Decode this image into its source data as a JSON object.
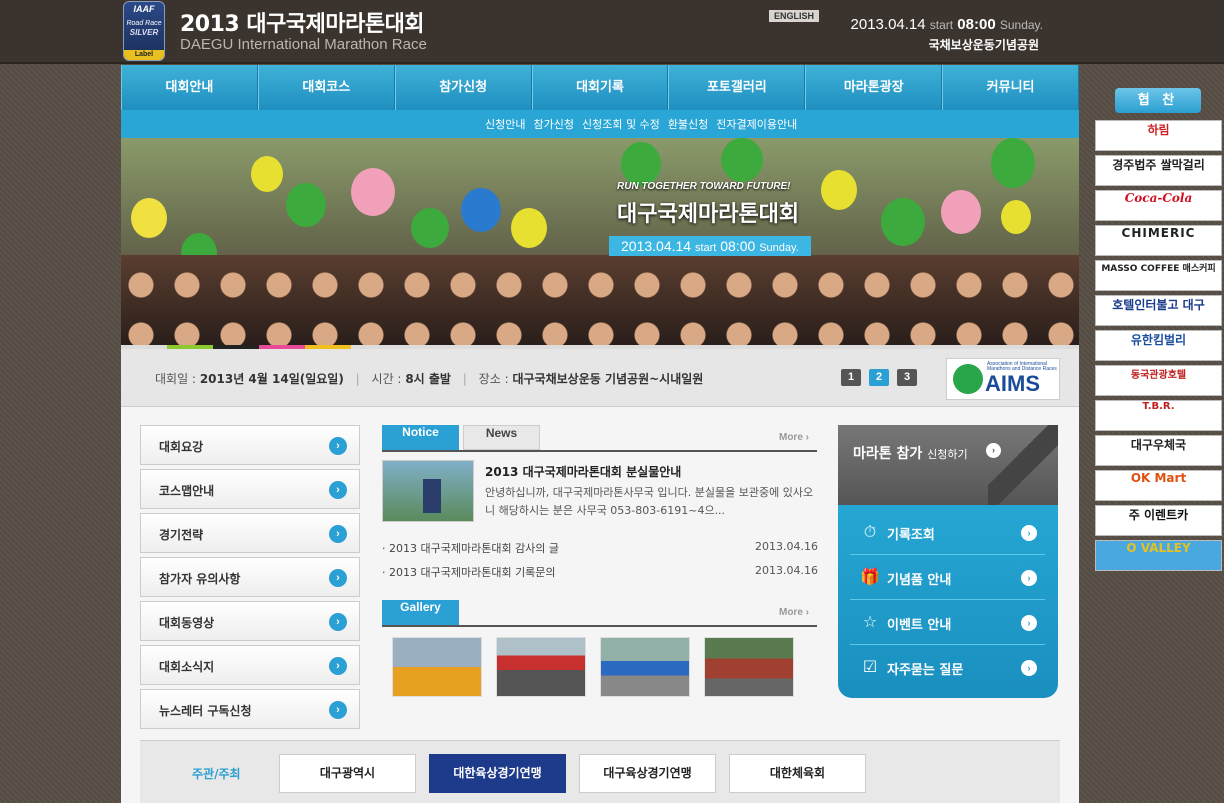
{
  "header": {
    "badge": {
      "iaaf": "IAAF",
      "road": "Road Race",
      "silver": "SILVER",
      "label": "Label"
    },
    "title": "2013 대구국제마라톤대회",
    "subtitle": "DAEGU International Marathon Race",
    "english": "ENGLISH",
    "date": "2013.04.14",
    "start": "start",
    "time": "08:00",
    "day": "Sunday.",
    "place": "국채보상운동기념공원"
  },
  "nav": [
    "대회안내",
    "대회코스",
    "참가신청",
    "대회기록",
    "포토갤러리",
    "마라톤광장",
    "커뮤니티"
  ],
  "subnav": [
    "신청안내",
    "참가신청",
    "신청조회 및 수정",
    "환불신청",
    "전자결제이용안내"
  ],
  "banner": {
    "slogan": "RUN TOGETHER TOWARD FUTURE!",
    "title": "대구국제마라톤대회",
    "date": "2013.04.14",
    "start": "start",
    "time": "08:00",
    "day": "Sunday."
  },
  "info": {
    "date_label": "대회일 :",
    "date_value": "2013년 4월 14일(일요일)",
    "time_label": "시간 :",
    "time_value": "8시 출발",
    "place_label": "장소 :",
    "place_value": "대구국채보상운동 기념공원~시내일원",
    "pages": [
      "1",
      "2",
      "3"
    ],
    "aims_name": "AIMS",
    "aims_tag": "Association of International Marathons and Distance Races"
  },
  "left_menu": [
    "대회요강",
    "코스맵안내",
    "경기전략",
    "참가자 유의사항",
    "대회동영상",
    "대회소식지",
    "뉴스레터 구독신청"
  ],
  "board": {
    "tab_notice": "Notice",
    "tab_news": "News",
    "more": "More",
    "feature_title": "2013 대구국제마라톤대회 분실물안내",
    "feature_summary": "안녕하십니까, 대구국제마라톤사무국 입니다. 분실물을 보관중에 있사오니 해당하시는 분은 사무국 053-803-6191~4으...",
    "items": [
      {
        "title": "2013 대구국제마라톤대회 감사의 글",
        "date": "2013.04.16"
      },
      {
        "title": "2013 대구국제마라톤대회 기록문의",
        "date": "2013.04.16"
      }
    ],
    "gallery_tab": "Gallery",
    "gallery_more": "More"
  },
  "side": {
    "head_main": "마라톤 참가",
    "head_small": "신청하기",
    "items": [
      {
        "label": "기록조회",
        "icon": "⏱"
      },
      {
        "label": "기념품 안내",
        "icon": "🎁"
      },
      {
        "label": "이벤트 안내",
        "icon": "☆"
      },
      {
        "label": "자주묻는 질문",
        "icon": "☑"
      }
    ]
  },
  "footer": {
    "label": "주관/주최",
    "logos": [
      "대구광역시",
      "대한육상경기연맹",
      "대구육상경기연맹",
      "대한체육회"
    ]
  },
  "cooperation": "협 찬",
  "sponsors": [
    "하림",
    "경주법주 쌀막걸리",
    "Coca-Cola",
    "CHIMERIC",
    "MASSO COFFEE 매스커피",
    "호텔인터불고 대구",
    "유한킴벌리",
    "동국관광호텔",
    "T.B.R.",
    "대구우체국",
    "OK Mart",
    "주 이렌트카",
    "O VALLEY"
  ]
}
